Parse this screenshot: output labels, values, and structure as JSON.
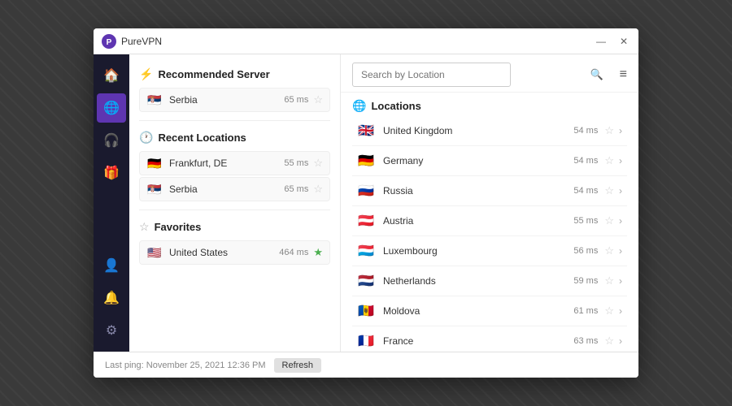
{
  "app": {
    "title": "PureVPN",
    "logo_icon": "🛡"
  },
  "titlebar": {
    "minimize_label": "—",
    "close_label": "✕"
  },
  "sidebar": {
    "items": [
      {
        "icon": "🏠",
        "label": "Home",
        "active": false
      },
      {
        "icon": "🌐",
        "label": "Locations",
        "active": true
      },
      {
        "icon": "🎧",
        "label": "Support",
        "active": false
      },
      {
        "icon": "🎁",
        "label": "Offers",
        "active": false
      },
      {
        "icon": "👤",
        "label": "Account",
        "active": false
      },
      {
        "icon": "🔔",
        "label": "Notifications",
        "active": false
      },
      {
        "icon": "⚙",
        "label": "Settings",
        "active": false
      }
    ]
  },
  "recommended": {
    "section_title": "Recommended Server",
    "server": {
      "name": "Serbia",
      "flag": "🇷🇸",
      "ping": "65 ms",
      "starred": false
    }
  },
  "recent": {
    "section_title": "Recent Locations",
    "servers": [
      {
        "name": "Frankfurt, DE",
        "flag": "🇩🇪",
        "ping": "55 ms",
        "starred": false
      },
      {
        "name": "Serbia",
        "flag": "🇷🇸",
        "ping": "65 ms",
        "starred": false
      }
    ]
  },
  "favorites": {
    "section_title": "Favorites",
    "servers": [
      {
        "name": "United States",
        "flag": "🇺🇸",
        "ping": "464 ms",
        "starred": true
      }
    ]
  },
  "search": {
    "placeholder": "Search by Location"
  },
  "locations": {
    "section_title": "Locations",
    "items": [
      {
        "name": "United Kingdom",
        "flag": "🇬🇧",
        "ping": "54 ms"
      },
      {
        "name": "Germany",
        "flag": "🇩🇪",
        "ping": "54 ms"
      },
      {
        "name": "Russia",
        "flag": "🇷🇺",
        "ping": "54 ms"
      },
      {
        "name": "Austria",
        "flag": "🇦🇹",
        "ping": "55 ms"
      },
      {
        "name": "Luxembourg",
        "flag": "🇱🇺",
        "ping": "56 ms"
      },
      {
        "name": "Netherlands",
        "flag": "🇳🇱",
        "ping": "59 ms"
      },
      {
        "name": "Moldova",
        "flag": "🇲🇩",
        "ping": "61 ms"
      },
      {
        "name": "France",
        "flag": "🇫🇷",
        "ping": "63 ms"
      }
    ]
  },
  "statusbar": {
    "last_ping_label": "Last ping: November 25, 2021 12:36 PM",
    "refresh_label": "Refresh"
  }
}
